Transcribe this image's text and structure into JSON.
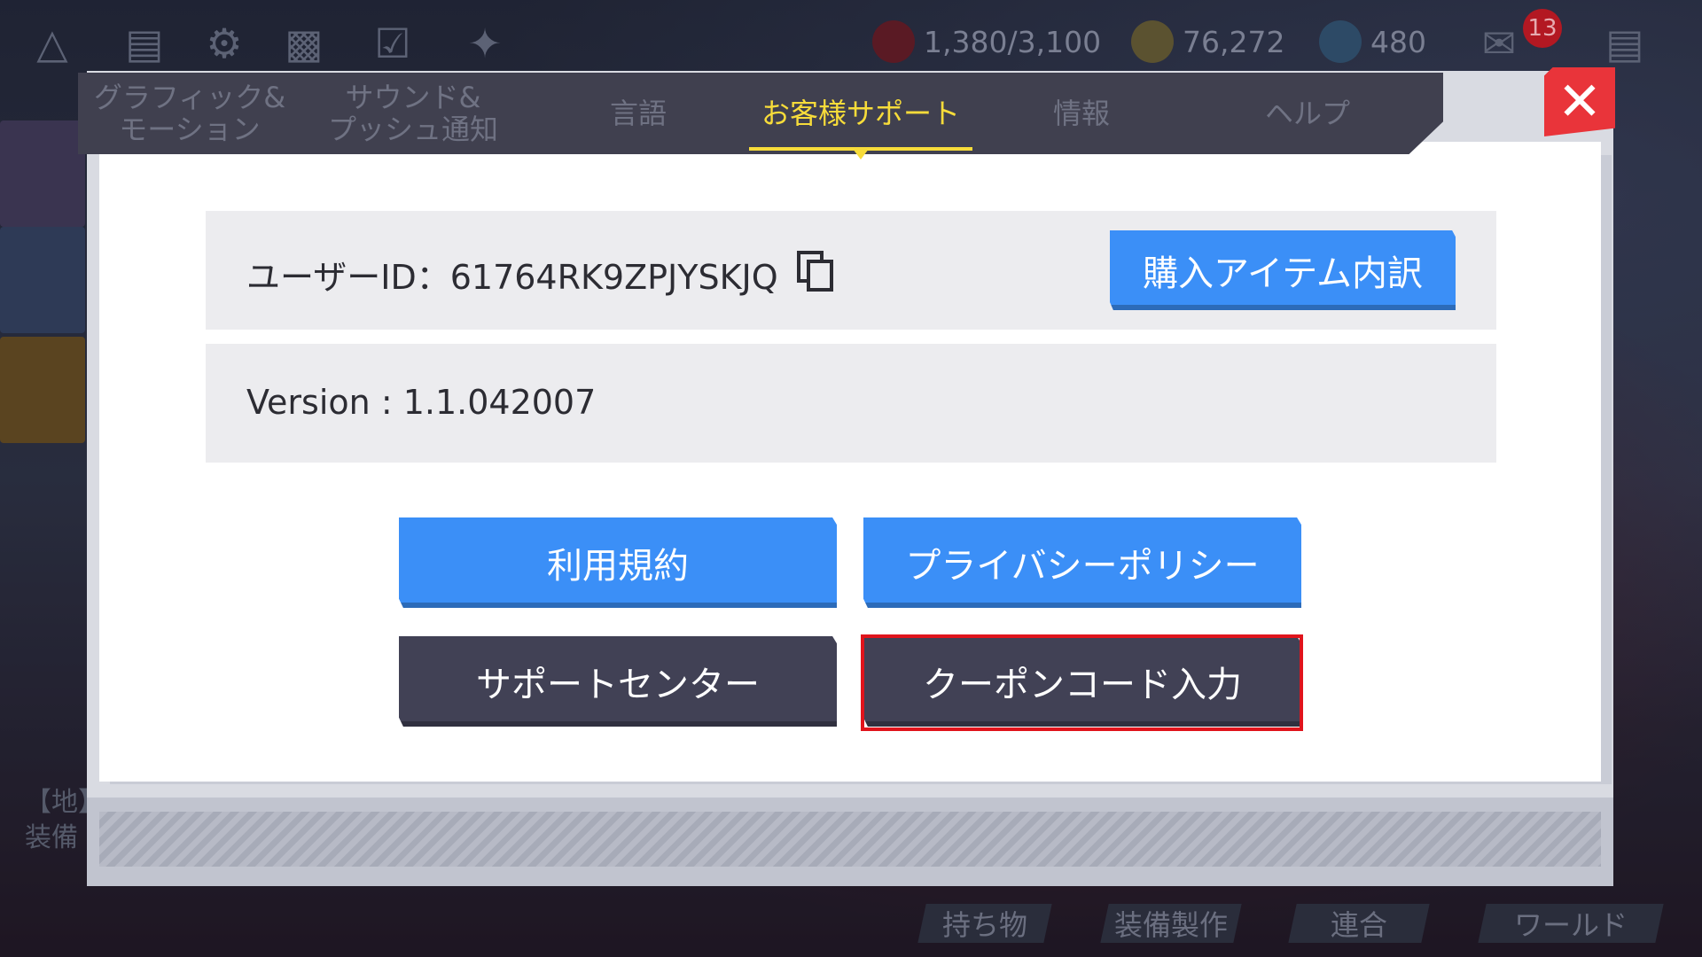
{
  "hud": {
    "stamina": "1,380/3,100",
    "gold": "76,272",
    "gems": "480",
    "mail_badge": "13"
  },
  "tabs": [
    {
      "label_line1": "グラフィック&",
      "label_line2": "モーション"
    },
    {
      "label_line1": "サウンド&",
      "label_line2": "プッシュ通知"
    },
    {
      "label": "言語"
    },
    {
      "label": "お客様サポート",
      "active": true
    },
    {
      "label": "情報"
    },
    {
      "label": "ヘルプ"
    }
  ],
  "support": {
    "user_id_label": "ユーザーID：",
    "user_id": "61764RK9ZPJYSKJQ",
    "purchase_history_button": "購入アイテム内訳",
    "version_label": "Version : ",
    "version": "1.1.042007",
    "terms_button": "利用規約",
    "privacy_button": "プライバシーポリシー",
    "support_center_button": "サポートセンター",
    "coupon_button": "クーポンコード入力"
  },
  "background": {
    "side_text_1": "【地】",
    "side_text_2": "装備",
    "bottom_menu": [
      "持ち物",
      "装備製作",
      "連合",
      "ワールド"
    ]
  },
  "colors": {
    "accent_yellow": "#f7dc3a",
    "button_blue": "#3b8ff7",
    "button_dark": "#414155",
    "close_red": "#e9343a",
    "highlight_red": "#e0141c"
  }
}
